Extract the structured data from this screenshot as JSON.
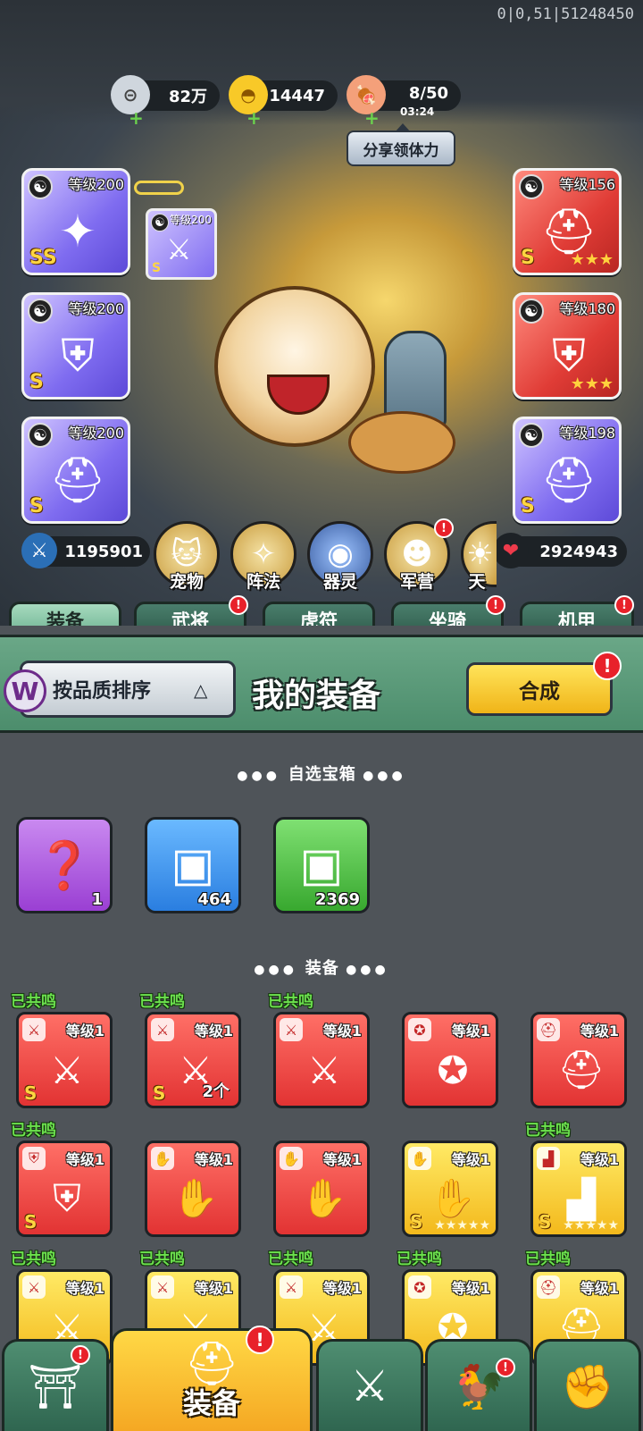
{
  "debug_id": "0|0,51|51248450",
  "resources": {
    "silver": {
      "icon": "silver-coin-icon",
      "value": "82万"
    },
    "gold": {
      "icon": "gold-ingot-icon",
      "value": "14447"
    },
    "stamina": {
      "icon": "meat-stamina-icon",
      "value": "8/50",
      "timer": "03:24"
    }
  },
  "share_stamina_label": "分享领体力",
  "equipped": {
    "left": [
      {
        "level": "等级200",
        "grade": "SS",
        "icon": "spear-icon"
      },
      {
        "level": "等级200",
        "grade": "S",
        "icon": "armor-icon"
      },
      {
        "level": "等级200",
        "grade": "S",
        "icon": "helmet-icon"
      }
    ],
    "linked": {
      "level": "等级200",
      "grade": "S",
      "icon": "weapon-icon"
    },
    "right": [
      {
        "level": "等级156",
        "grade": "S",
        "icon": "helmet-icon",
        "stars": "★★★"
      },
      {
        "level": "等级180",
        "grade": "",
        "icon": "armor-icon",
        "stars": "★★★"
      },
      {
        "level": "等级198",
        "grade": "S",
        "icon": "helmet-icon",
        "stars": ""
      }
    ]
  },
  "attack_power": "1195901",
  "health": "2924943",
  "functions": [
    {
      "label": "宠物",
      "icon": "cat-pet-icon"
    },
    {
      "label": "阵法",
      "icon": "formation-compass-icon"
    },
    {
      "label": "器灵",
      "icon": "spirit-icon"
    },
    {
      "label": "军营",
      "icon": "barracks-soldier-icon"
    },
    {
      "label": "天",
      "icon": "heaven-icon"
    }
  ],
  "tabs": [
    "装备",
    "武将",
    "虎符",
    "坐骑",
    "机甲"
  ],
  "panel": {
    "sort_label": "按品质排序",
    "title": "我的装备",
    "compose_label": "合成",
    "badge": "!"
  },
  "selectable_chest_title": "自选宝箱",
  "chests": [
    {
      "count": "1",
      "color": "#a74ee0",
      "icon": "mystery-chest-icon"
    },
    {
      "count": "464",
      "color": "#2f86e6",
      "icon": "blue-chest-icon"
    },
    {
      "count": "2369",
      "color": "#3fb034",
      "icon": "green-chest-icon"
    }
  ],
  "equipment_title": "装备",
  "resonance_label": "已共鸣",
  "items": [
    {
      "level": "等级1",
      "grade": "S",
      "rarity": "red",
      "slot": "sword",
      "resonated": true,
      "qty": "",
      "stars": ""
    },
    {
      "level": "等级1",
      "grade": "S",
      "rarity": "red",
      "slot": "sword",
      "resonated": true,
      "qty": "2个",
      "stars": ""
    },
    {
      "level": "等级1",
      "grade": "",
      "rarity": "red",
      "slot": "sword",
      "resonated": true,
      "qty": "",
      "stars": ""
    },
    {
      "level": "等级1",
      "grade": "",
      "rarity": "red",
      "slot": "medal",
      "resonated": false,
      "qty": "",
      "stars": ""
    },
    {
      "level": "等级1",
      "grade": "",
      "rarity": "red",
      "slot": "helmet",
      "resonated": false,
      "qty": "",
      "stars": ""
    },
    {
      "level": "等级1",
      "grade": "S",
      "rarity": "red",
      "slot": "armor",
      "resonated": true,
      "qty": "",
      "stars": ""
    },
    {
      "level": "等级1",
      "grade": "",
      "rarity": "red",
      "slot": "glove",
      "resonated": false,
      "qty": "",
      "stars": ""
    },
    {
      "level": "等级1",
      "grade": "",
      "rarity": "red",
      "slot": "glove",
      "resonated": false,
      "qty": "",
      "stars": ""
    },
    {
      "level": "等级1",
      "grade": "S",
      "rarity": "gold",
      "slot": "glove",
      "resonated": false,
      "qty": "",
      "stars": "★★★★★"
    },
    {
      "level": "等级1",
      "grade": "S",
      "rarity": "gold",
      "slot": "boot",
      "resonated": true,
      "qty": "",
      "stars": "★★★★★"
    },
    {
      "level": "等级1",
      "grade": "",
      "rarity": "gold",
      "slot": "sword",
      "resonated": true,
      "qty": "",
      "stars": ""
    },
    {
      "level": "等级1",
      "grade": "",
      "rarity": "gold",
      "slot": "sword",
      "resonated": true,
      "qty": "",
      "stars": ""
    },
    {
      "level": "等级1",
      "grade": "",
      "rarity": "gold",
      "slot": "sword",
      "resonated": true,
      "qty": "",
      "stars": ""
    },
    {
      "level": "等级1",
      "grade": "",
      "rarity": "gold",
      "slot": "medal",
      "resonated": true,
      "qty": "",
      "stars": ""
    },
    {
      "level": "等级1",
      "grade": "",
      "rarity": "gold",
      "slot": "helmet",
      "resonated": true,
      "qty": "",
      "stars": ""
    }
  ],
  "bottom_nav": [
    {
      "label": "",
      "icon": "shop-gate-icon"
    },
    {
      "label": "装备",
      "icon": "helmet-equipment-icon"
    },
    {
      "label": "",
      "icon": "sword-shield-icon"
    },
    {
      "label": "",
      "icon": "rooster-team-icon"
    },
    {
      "label": "",
      "icon": "fist-upgrade-icon"
    }
  ]
}
